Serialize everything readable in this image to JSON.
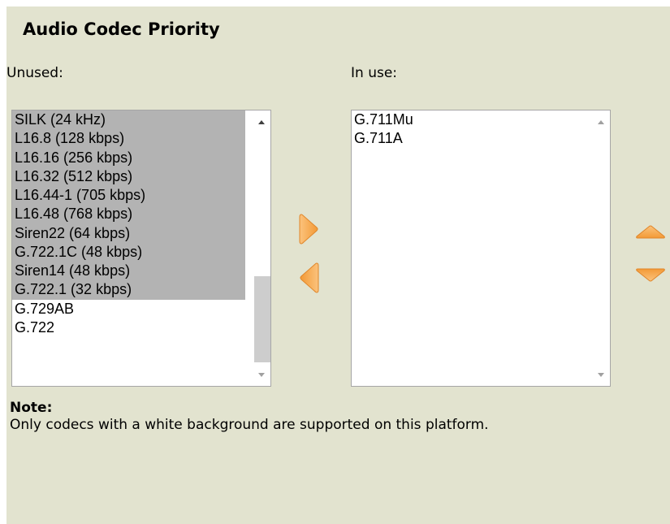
{
  "section": {
    "title": "Audio Codec Priority"
  },
  "unused": {
    "label": "Unused:",
    "items": [
      {
        "label": "SILK (24 kHz)",
        "supported": false
      },
      {
        "label": "L16.8 (128 kbps)",
        "supported": false
      },
      {
        "label": "L16.16 (256 kbps)",
        "supported": false
      },
      {
        "label": "L16.32 (512 kbps)",
        "supported": false
      },
      {
        "label": "L16.44-1 (705 kbps)",
        "supported": false
      },
      {
        "label": "L16.48 (768 kbps)",
        "supported": false
      },
      {
        "label": "Siren22 (64 kbps)",
        "supported": false
      },
      {
        "label": "G.722.1C (48 kbps)",
        "supported": false
      },
      {
        "label": "Siren14 (48 kbps)",
        "supported": false
      },
      {
        "label": "G.722.1 (32 kbps)",
        "supported": false
      },
      {
        "label": "G.729AB",
        "supported": true
      },
      {
        "label": "G.722",
        "supported": true
      }
    ]
  },
  "in_use": {
    "label": "In use:",
    "items": [
      {
        "label": "G.711Mu",
        "supported": true
      },
      {
        "label": "G.711A",
        "supported": true
      }
    ]
  },
  "buttons": {
    "add_icon": "arrow-right-icon",
    "remove_icon": "arrow-left-icon",
    "move_up_icon": "arrow-up-icon",
    "move_down_icon": "arrow-down-icon"
  },
  "colors": {
    "panel_background": "#e2e3cf",
    "unsupported_item": "#b3b3b3",
    "supported_item": "#ffffff",
    "arrow_orange": "#f7a64a"
  },
  "note": {
    "title": "Note:",
    "text": "Only codecs with a white background are supported on this platform."
  }
}
